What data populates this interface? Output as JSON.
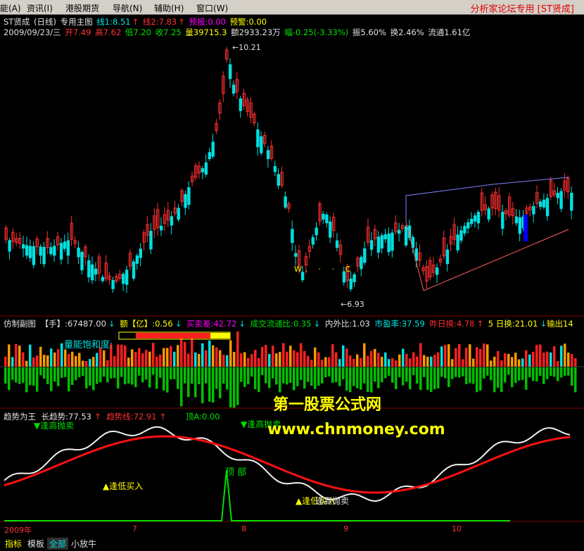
{
  "menu": {
    "items": [
      "功能(A)",
      "资讯(I)",
      "港股期货",
      "导航(N)",
      "辅助(H)",
      "窗口(W)"
    ],
    "active_index": 3,
    "brand": "分析家论坛专用 [ST贤成]"
  },
  "main_chart": {
    "header1": {
      "name": "ST贤成",
      "period": "(日线)",
      "title": "专用主图",
      "line1": "线1:8.51",
      "line2": "线2:7.83",
      "forecast": "预报:0.00",
      "alert": "预警:0.00"
    },
    "header2": {
      "date": "2009/09/23/三",
      "open": "开7.49",
      "high": "高7.62",
      "low": "低7.20",
      "close": "收7.25",
      "volume": "量39715.3",
      "amount": "额2933.23万",
      "change": "幅-0.25(-3.33%)",
      "amplitude": "振5.60%",
      "turnover": "换2.46%",
      "float": "流通1.61亿"
    },
    "price_high_label": "10.21",
    "price_low_label": "6.93",
    "bright_strip_text": "W. · · C",
    "colors": {
      "up": "#ff3030",
      "down": "#00e0e0",
      "highlight_bar": "#0000ff",
      "upper_line": "#8080ff",
      "lower_line": "#ff6060"
    }
  },
  "sub_chart": {
    "title": "仿制副图",
    "hand": "【手】:67487.00",
    "amount": "额【亿】:0.56",
    "buy_sell_diff": "买卖差:42.72",
    "turnover_ratio": "成交流通比:0.35",
    "in_out_ratio": "内外比:1.03",
    "pe": "市盈率:37.59",
    "prev_turnover": "昨日换:4.78",
    "five_day_turnover": "5 日换:21.01",
    "output": "输出14",
    "saturation_label": "量能饱和度:"
  },
  "trend_chart": {
    "title": "趋势为王",
    "long_trend": "长趋势:77.53",
    "trend_line": "趋势线:72.91",
    "top_a": "顶A:0.00",
    "label_high_sell_1": "逢高抛卖",
    "label_high_sell_2": "逢高抛卖",
    "label_low_buy_1": "逢低买入",
    "label_low_buy_2": "逢低买入",
    "label_high_sell_3": "逢高抛卖",
    "label_top": "顶 部",
    "axis_labels": [
      "2009年",
      "7",
      "8",
      "9",
      "10"
    ]
  },
  "watermark": {
    "line1": "第一股票公式网",
    "line2": "www.chnmoney.com"
  },
  "bottom_tabs": [
    "指标",
    "模板",
    "全部",
    "小放牛"
  ]
}
